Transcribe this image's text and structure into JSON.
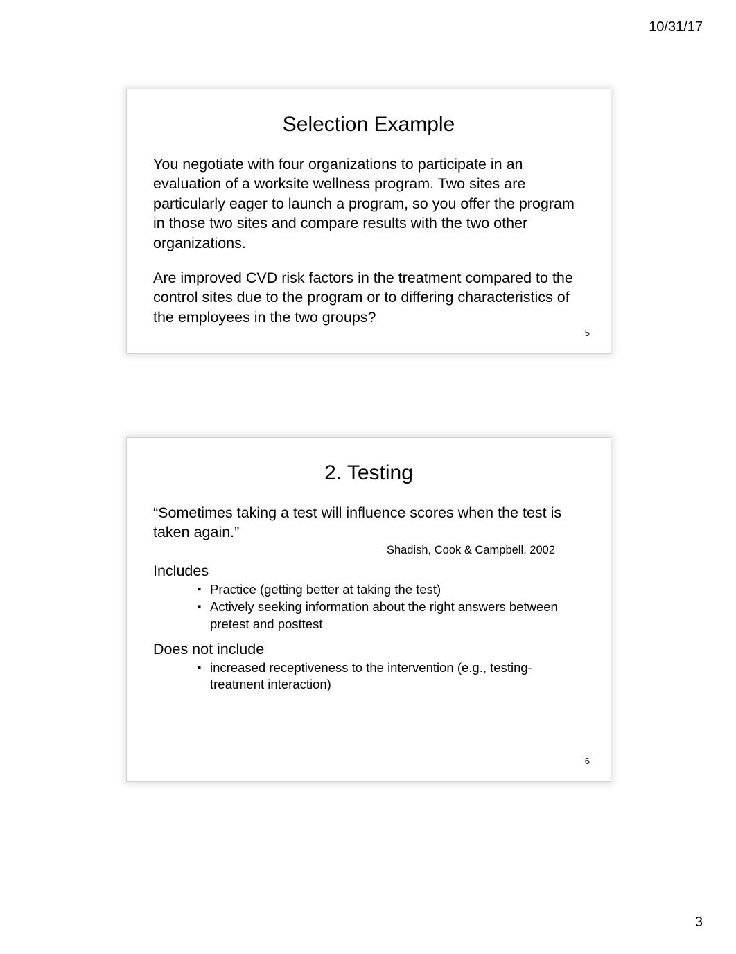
{
  "header": {
    "date": "10/31/17"
  },
  "footer": {
    "page": "3"
  },
  "slide1": {
    "title": "Selection Example",
    "para1": "You negotiate with four organizations to participate in an evaluation of a worksite wellness program. Two sites are particularly eager to launch a program, so you offer the program in those two sites and compare results with the two other organizations.",
    "para2": "Are improved CVD risk factors in the treatment compared to the control sites due to the program or to differing characteristics of the employees in the two groups?",
    "num": "5"
  },
  "slide2": {
    "title": "2. Testing",
    "quote": "“Sometimes taking a test will influence scores when the test is taken again.”",
    "citation": "Shadish, Cook & Campbell, 2002",
    "includes_label": "Includes",
    "includes_b1": "Practice (getting better at taking the test)",
    "includes_b2": "Actively seeking information about the right answers between pretest and posttest",
    "doesnot_label": "Does not include",
    "doesnot_b1": "increased receptiveness to the intervention (e.g., testing-treatment interaction)",
    "num": "6"
  }
}
